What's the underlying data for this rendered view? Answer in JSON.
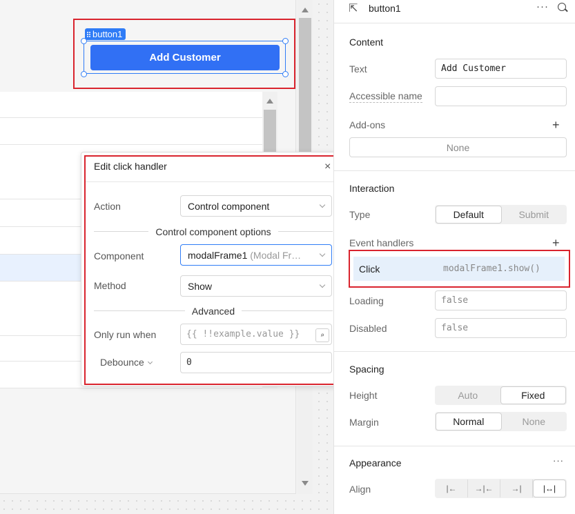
{
  "canvas": {
    "component_tag": "button1",
    "button_label": "Add Customer"
  },
  "popover": {
    "title": "Edit click handler",
    "close_icon": "×",
    "action_label": "Action",
    "action_value": "Control component",
    "section_options": "Control component options",
    "component_label": "Component",
    "component_value": "modalFrame1",
    "component_type": "(Modal Fr…",
    "method_label": "Method",
    "method_value": "Show",
    "section_advanced": "Advanced",
    "only_run_label": "Only run when",
    "only_run_placeholder": "{{ !!example.value }}",
    "debounce_label": "Debounce",
    "debounce_value": "0"
  },
  "inspector": {
    "component_name": "button1",
    "more_icon": "···",
    "content": {
      "title": "Content",
      "text_label": "Text",
      "text_value": "Add Customer",
      "accessible_label": "Accessible name",
      "accessible_value": "",
      "addons_label": "Add-ons",
      "addons_value": "None"
    },
    "interaction": {
      "title": "Interaction",
      "type_label": "Type",
      "type_options": [
        "Default",
        "Submit"
      ],
      "type_selected": "Default",
      "event_handlers_label": "Event handlers",
      "handler_event": "Click",
      "handler_action": "modalFrame1.show()",
      "loading_label": "Loading",
      "loading_value": "false",
      "disabled_label": "Disabled",
      "disabled_value": "false"
    },
    "spacing": {
      "title": "Spacing",
      "height_label": "Height",
      "height_options": [
        "Auto",
        "Fixed"
      ],
      "height_selected": "Fixed",
      "margin_label": "Margin",
      "margin_options": [
        "Normal",
        "None"
      ],
      "margin_selected": "Normal"
    },
    "appearance": {
      "title": "Appearance",
      "more_icon": "···",
      "align_label": "Align",
      "align_options": [
        "|←",
        "→|←",
        "→|",
        "|↔|"
      ],
      "align_selected": "|↔|"
    }
  },
  "plus_icon": "+",
  "colors": {
    "accent": "#3170f4",
    "highlight": "#d9232d",
    "selected_row": "#e6f0fb"
  }
}
